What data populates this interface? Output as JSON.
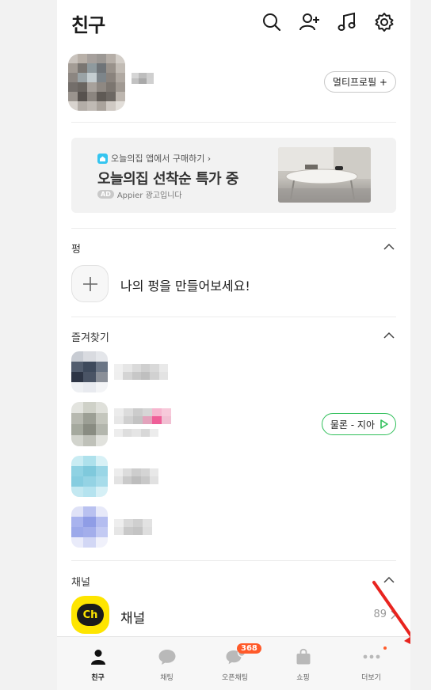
{
  "header": {
    "title": "친구",
    "icons": [
      "search-icon",
      "add-friend-icon",
      "music-icon",
      "settings-icon"
    ]
  },
  "profile": {
    "multi_profile_label": "멀티프로필 +"
  },
  "ad": {
    "brand": "오늘의집 앱에서 구매하기 ›",
    "headline": "오늘의집 선착순 특가 중",
    "ad_tag": "AD",
    "sponsor": "Appier 광고입니다"
  },
  "story": {
    "section_title": "펑",
    "create_text": "나의 펑을 만들어보세요!"
  },
  "favorites": {
    "section_title": "즐겨찾기",
    "music_pill": "물론 - 지아"
  },
  "channel": {
    "section_title": "채널",
    "logo_text": "Ch",
    "name": "채널",
    "count": "89"
  },
  "tabs": [
    {
      "label": "친구",
      "icon": "person-icon",
      "active": true
    },
    {
      "label": "채팅",
      "icon": "chat-icon"
    },
    {
      "label": "오픈채팅",
      "icon": "open-chat-icon",
      "badge": "368"
    },
    {
      "label": "쇼핑",
      "icon": "shopping-bag-icon"
    },
    {
      "label": "더보기",
      "icon": "more-icon"
    }
  ],
  "colors": {
    "accent_green": "#2fbf59",
    "badge_orange": "#ff5a2a",
    "channel_yellow": "#fee500",
    "annotation_arrow": "#e8241f"
  }
}
